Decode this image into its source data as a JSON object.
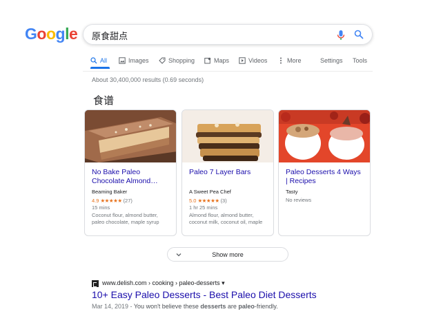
{
  "logo": {
    "letters": [
      {
        "ch": "G",
        "color": "#4285F4"
      },
      {
        "ch": "o",
        "color": "#EA4335"
      },
      {
        "ch": "o",
        "color": "#FBBC05"
      },
      {
        "ch": "g",
        "color": "#4285F4"
      },
      {
        "ch": "l",
        "color": "#34A853"
      },
      {
        "ch": "e",
        "color": "#EA4335"
      }
    ]
  },
  "search": {
    "query": "原食甜点",
    "mic_icon": "mic-icon",
    "search_icon": "search-icon"
  },
  "tabs": [
    {
      "label": "All",
      "icon": "search-icon",
      "active": true
    },
    {
      "label": "Images",
      "icon": "image-icon"
    },
    {
      "label": "Shopping",
      "icon": "tag-icon"
    },
    {
      "label": "Maps",
      "icon": "map-icon"
    },
    {
      "label": "Videos",
      "icon": "video-icon"
    },
    {
      "label": "More",
      "icon": "more-vert-icon"
    },
    {
      "label": "Settings"
    },
    {
      "label": "Tools"
    }
  ],
  "result_stats": "About 30,400,000 results (0.69 seconds)",
  "recipes": {
    "title": "食谱",
    "cards": [
      {
        "title": "No Bake Paleo Chocolate Almond…",
        "source": "Beaming Baker",
        "rating": "4.9",
        "stars": "★★★★★",
        "reviews": "(27)",
        "time": "15 mins",
        "ingredients": "Coconut flour, almond butter, paleo chocolate, maple syrup"
      },
      {
        "title": "Paleo 7 Layer Bars",
        "source": "A Sweet Pea Chef",
        "rating": "5.0",
        "stars": "★★★★★",
        "reviews": "(3)",
        "time": "1 hr 25 mins",
        "ingredients": "Almond flour, almond butter, coconut milk, coconut oil, maple"
      },
      {
        "title": "Paleo Desserts 4 Ways | Recipes",
        "source": "Tasty",
        "no_reviews": "No reviews"
      }
    ],
    "show_more": "Show more"
  },
  "result": {
    "url": "www.delish.com › cooking › paleo-desserts ▾",
    "title": "10+ Easy Paleo Desserts - Best Paleo Diet Desserts",
    "date": "Mar 14, 2019 - ",
    "snippet_a": "You won't believe these ",
    "snippet_b": "desserts",
    "snippet_c": " are ",
    "snippet_d": "paleo",
    "snippet_e": "-friendly."
  },
  "colors": {
    "link": "#1a0dab",
    "accent": "#1a73e8",
    "star": "#e7711b"
  }
}
